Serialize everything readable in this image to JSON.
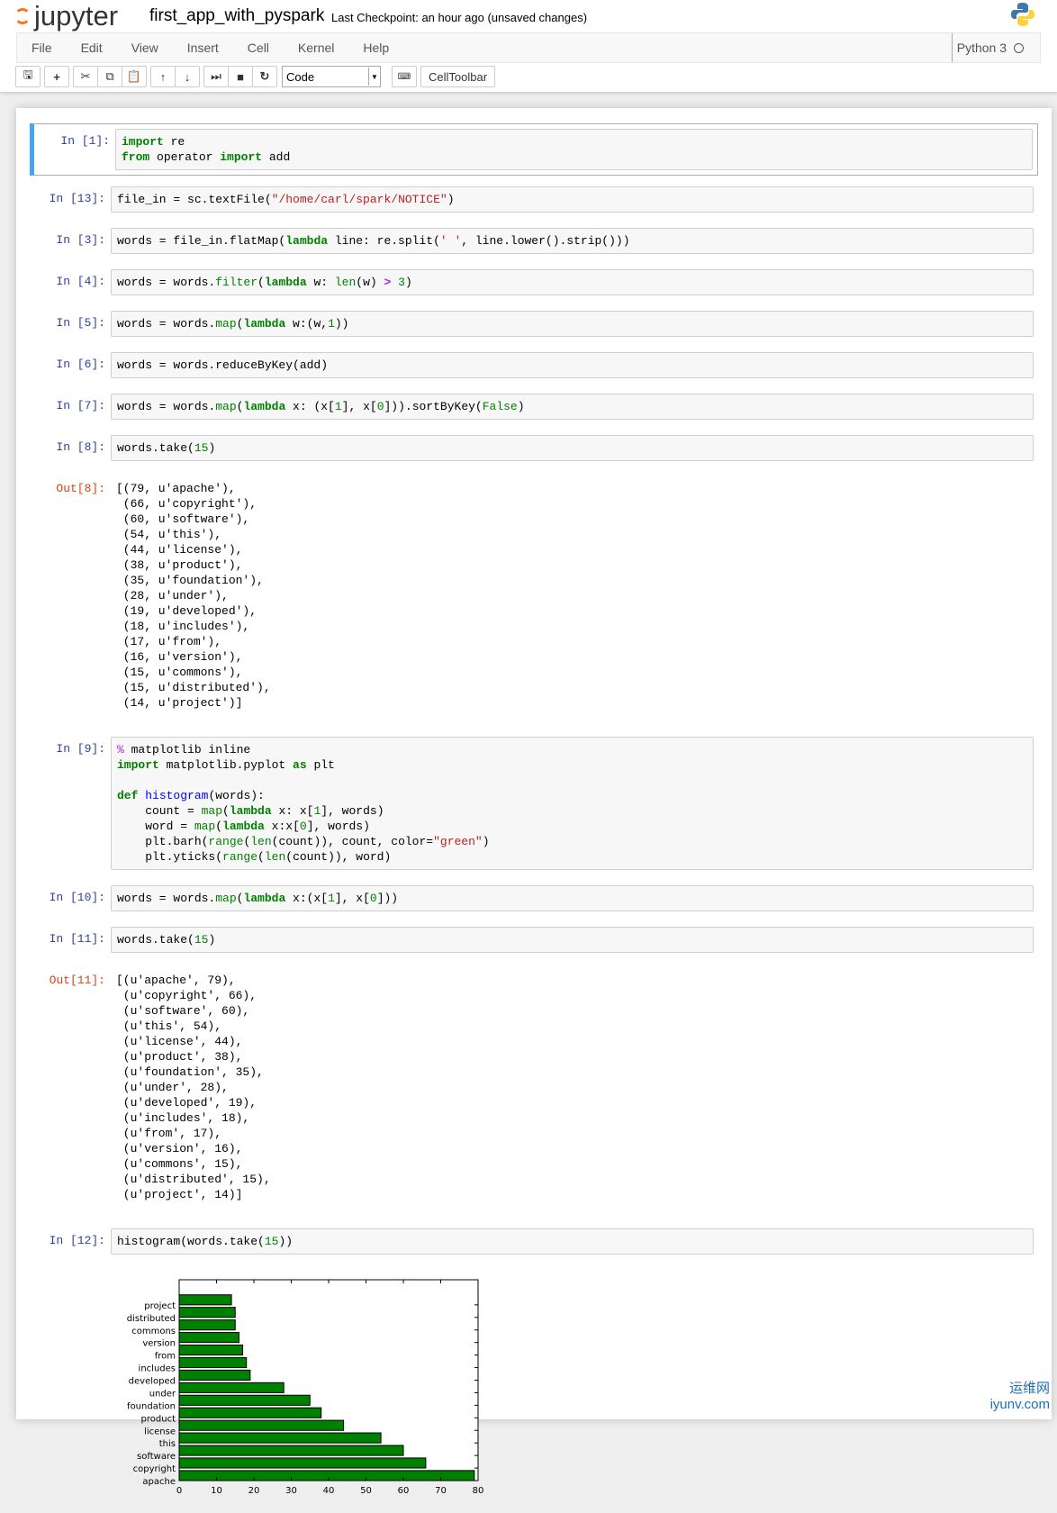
{
  "header": {
    "logo": "jupyter",
    "notebook_name": "first_app_with_pyspark",
    "checkpoint": "Last Checkpoint: an hour ago (unsaved changes)"
  },
  "menu": [
    "File",
    "Edit",
    "View",
    "Insert",
    "Cell",
    "Kernel",
    "Help"
  ],
  "kernel": {
    "name": "Python 3",
    "status": "idle"
  },
  "toolbar": {
    "cell_type": "Code",
    "celltoolbar": "CellToolbar",
    "buttons": [
      "save-icon",
      "plus-icon",
      "cut-icon",
      "copy-icon",
      "paste-icon",
      "arrow-up-icon",
      "arrow-down-icon",
      "step-forward-icon",
      "stop-icon",
      "refresh-icon",
      "keyboard-icon"
    ]
  },
  "cells": [
    {
      "prompt": "In [1]:",
      "selected": true,
      "lines": [
        [
          [
            "k",
            "import"
          ],
          [
            "",
            " re"
          ]
        ],
        [
          [
            "k",
            "from"
          ],
          [
            "",
            " operator "
          ],
          [
            "k",
            "import"
          ],
          [
            "",
            " add"
          ]
        ]
      ]
    },
    {
      "prompt": "In [13]:",
      "lines": [
        [
          [
            "",
            "file_in = sc.textFile("
          ],
          [
            "s",
            "\"/home/carl/spark/NOTICE\""
          ],
          [
            "",
            ")"
          ]
        ]
      ]
    },
    {
      "prompt": "In [3]:",
      "lines": [
        [
          [
            "",
            "words = file_in.flatMap("
          ],
          [
            "k",
            "lambda"
          ],
          [
            "",
            " line: re.split("
          ],
          [
            "s",
            "' '"
          ],
          [
            "",
            ", line.lower().strip()))"
          ]
        ]
      ]
    },
    {
      "prompt": "In [4]:",
      "lines": [
        [
          [
            "",
            "words = words."
          ],
          [
            "b",
            "filter"
          ],
          [
            "",
            "("
          ],
          [
            "k",
            "lambda"
          ],
          [
            "",
            " w: "
          ],
          [
            "b",
            "len"
          ],
          [
            "",
            "(w) "
          ],
          [
            "o",
            ">"
          ],
          [
            "",
            " "
          ],
          [
            "n",
            "3"
          ],
          [
            "",
            ")"
          ]
        ]
      ]
    },
    {
      "prompt": "In [5]:",
      "lines": [
        [
          [
            "",
            "words = words."
          ],
          [
            "b",
            "map"
          ],
          [
            "",
            "("
          ],
          [
            "k",
            "lambda"
          ],
          [
            "",
            " w:(w,"
          ],
          [
            "n",
            "1"
          ],
          [
            "",
            "))"
          ]
        ]
      ]
    },
    {
      "prompt": "In [6]:",
      "lines": [
        [
          [
            "",
            "words = words.reduceByKey(add)"
          ]
        ]
      ]
    },
    {
      "prompt": "In [7]:",
      "lines": [
        [
          [
            "",
            "words = words."
          ],
          [
            "b",
            "map"
          ],
          [
            "",
            "("
          ],
          [
            "k",
            "lambda"
          ],
          [
            "",
            " x: (x["
          ],
          [
            "n",
            "1"
          ],
          [
            "",
            "], x["
          ],
          [
            "n",
            "0"
          ],
          [
            "",
            "])).sortByKey("
          ],
          [
            "b",
            "False"
          ],
          [
            "",
            ")"
          ]
        ]
      ]
    },
    {
      "prompt": "In [8]:",
      "lines": [
        [
          [
            "",
            "words.take("
          ],
          [
            "n",
            "15"
          ],
          [
            "",
            ")"
          ]
        ]
      ],
      "out_prompt": "Out[8]:",
      "output": "[(79, u'apache'),\n (66, u'copyright'),\n (60, u'software'),\n (54, u'this'),\n (44, u'license'),\n (38, u'product'),\n (35, u'foundation'),\n (28, u'under'),\n (19, u'developed'),\n (18, u'includes'),\n (17, u'from'),\n (16, u'version'),\n (15, u'commons'),\n (15, u'distributed'),\n (14, u'project')]"
    },
    {
      "prompt": "In [9]:",
      "lines": [
        [
          [
            "m",
            "%"
          ],
          [
            "",
            " matplotlib inline"
          ]
        ],
        [
          [
            "k",
            "import"
          ],
          [
            "",
            " matplotlib.pyplot "
          ],
          [
            "k",
            "as"
          ],
          [
            "",
            " plt"
          ]
        ],
        [],
        [
          [
            "k",
            "def"
          ],
          [
            "",
            " "
          ],
          [
            "f",
            "histogram"
          ],
          [
            "",
            "(words):"
          ]
        ],
        [
          [
            "",
            "    count = "
          ],
          [
            "b",
            "map"
          ],
          [
            "",
            "("
          ],
          [
            "k",
            "lambda"
          ],
          [
            "",
            " x: x["
          ],
          [
            "n",
            "1"
          ],
          [
            "",
            "], words)"
          ]
        ],
        [
          [
            "",
            "    word = "
          ],
          [
            "b",
            "map"
          ],
          [
            "",
            "("
          ],
          [
            "k",
            "lambda"
          ],
          [
            "",
            " x:x["
          ],
          [
            "n",
            "0"
          ],
          [
            "",
            "], words)"
          ]
        ],
        [
          [
            "",
            "    plt.barh("
          ],
          [
            "b",
            "range"
          ],
          [
            "",
            "("
          ],
          [
            "b",
            "len"
          ],
          [
            "",
            "(count)), count, color="
          ],
          [
            "s",
            "\"green\""
          ],
          [
            "",
            ")"
          ]
        ],
        [
          [
            "",
            "    plt.yticks("
          ],
          [
            "b",
            "range"
          ],
          [
            "",
            "("
          ],
          [
            "b",
            "len"
          ],
          [
            "",
            "(count)), word)"
          ]
        ]
      ]
    },
    {
      "prompt": "In [10]:",
      "lines": [
        [
          [
            "",
            "words = words."
          ],
          [
            "b",
            "map"
          ],
          [
            "",
            "("
          ],
          [
            "k",
            "lambda"
          ],
          [
            "",
            " x:(x["
          ],
          [
            "n",
            "1"
          ],
          [
            "",
            "], x["
          ],
          [
            "n",
            "0"
          ],
          [
            "",
            "]))"
          ]
        ]
      ]
    },
    {
      "prompt": "In [11]:",
      "lines": [
        [
          [
            "",
            "words.take("
          ],
          [
            "n",
            "15"
          ],
          [
            "",
            ")"
          ]
        ]
      ],
      "out_prompt": "Out[11]:",
      "output": "[(u'apache', 79),\n (u'copyright', 66),\n (u'software', 60),\n (u'this', 54),\n (u'license', 44),\n (u'product', 38),\n (u'foundation', 35),\n (u'under', 28),\n (u'developed', 19),\n (u'includes', 18),\n (u'from', 17),\n (u'version', 16),\n (u'commons', 15),\n (u'distributed', 15),\n (u'project', 14)]"
    },
    {
      "prompt": "In [12]:",
      "lines": [
        [
          [
            "",
            "histogram(words.take("
          ],
          [
            "n",
            "15"
          ],
          [
            "",
            "))"
          ]
        ]
      ],
      "has_chart": true
    }
  ],
  "chart_data": {
    "type": "bar",
    "orientation": "horizontal",
    "categories": [
      "apache",
      "copyright",
      "software",
      "this",
      "license",
      "product",
      "foundation",
      "under",
      "developed",
      "includes",
      "from",
      "version",
      "commons",
      "distributed",
      "project"
    ],
    "values": [
      79,
      66,
      60,
      54,
      44,
      38,
      35,
      28,
      19,
      18,
      17,
      16,
      15,
      15,
      14
    ],
    "xlim": [
      0,
      80
    ],
    "ylim": [
      0,
      16
    ],
    "xticks": [
      0,
      10,
      20,
      30,
      40,
      50,
      60,
      70,
      80
    ],
    "color": "#008000",
    "title": "",
    "xlabel": "",
    "ylabel": ""
  },
  "watermark": {
    "cn": "运维网",
    "url": "iyunv.com"
  }
}
